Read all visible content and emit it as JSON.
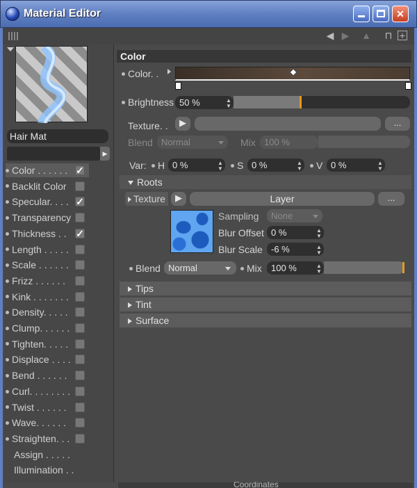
{
  "window": {
    "title": "Material Editor",
    "min_label": "",
    "max_label": "",
    "close_label": "✕"
  },
  "material": {
    "name": "Hair Mat"
  },
  "channels": [
    {
      "label": "Color . . . . . .",
      "checked": true,
      "active": true
    },
    {
      "label": "Backlit Color",
      "checked": false
    },
    {
      "label": "Specular. . . .",
      "checked": true
    },
    {
      "label": "Transparency",
      "checked": false
    },
    {
      "label": "Thickness . .",
      "checked": true
    },
    {
      "label": "Length . . . . .",
      "checked": false
    },
    {
      "label": "Scale . . . . . .",
      "checked": false
    },
    {
      "label": "Frizz . . . . . .",
      "checked": false
    },
    {
      "label": "Kink . . . . . . .",
      "checked": false
    },
    {
      "label": "Density. . . . .",
      "checked": false
    },
    {
      "label": "Clump. . . . . .",
      "checked": false
    },
    {
      "label": "Tighten. . . . .",
      "checked": false
    },
    {
      "label": "Displace . . . .",
      "checked": false
    },
    {
      "label": "Bend . . . . . .",
      "checked": false
    },
    {
      "label": "Curl. . . . . . . .",
      "checked": false
    },
    {
      "label": "Twist . . . . . .",
      "checked": false
    },
    {
      "label": "Wave. . . . . .",
      "checked": false
    },
    {
      "label": "Straighten. . .",
      "checked": false
    },
    {
      "label": "Assign . . . . .",
      "checked": null
    },
    {
      "label": "Illumination . .",
      "checked": null
    }
  ],
  "color_panel": {
    "header": "Color",
    "color_label": "Color. .",
    "brightness_label": "Brightness",
    "brightness_value": "50 %",
    "brightness_level": 0.38,
    "texture_label": "Texture. .",
    "texture_more": "...",
    "blend_label": "Blend",
    "blend_value": "Normal",
    "mix_label": "Mix",
    "mix_value": "100 %",
    "var_label": "Var:",
    "h_label": "H",
    "h_value": "0 %",
    "s_label": "S",
    "s_value": "0 %",
    "v_label": "V",
    "v_value": "0 %"
  },
  "roots": {
    "header": "Roots",
    "texture_label": "Texture",
    "layer_label": "Layer",
    "more": "...",
    "sampling_label": "Sampling",
    "sampling_value": "None",
    "blur_offset_label": "Blur Offset",
    "blur_offset_value": "0 %",
    "blur_scale_label": "Blur Scale",
    "blur_scale_value": "-6 %",
    "blend_label": "Blend",
    "blend_value": "Normal",
    "mix_label": "Mix",
    "mix_value": "100 %",
    "mix_level": 1.0
  },
  "sections": [
    "Tips",
    "Tint",
    "Surface"
  ],
  "footer_partial": "Coordinates",
  "colors": {
    "accent": "#e39a1c",
    "titlebar": "#5f7fc2",
    "panel": "#4a4a4a"
  },
  "icons": [
    "back-arrow-icon",
    "forward-arrow-icon",
    "up-arrow-icon",
    "lock-icon",
    "new-window-icon"
  ]
}
